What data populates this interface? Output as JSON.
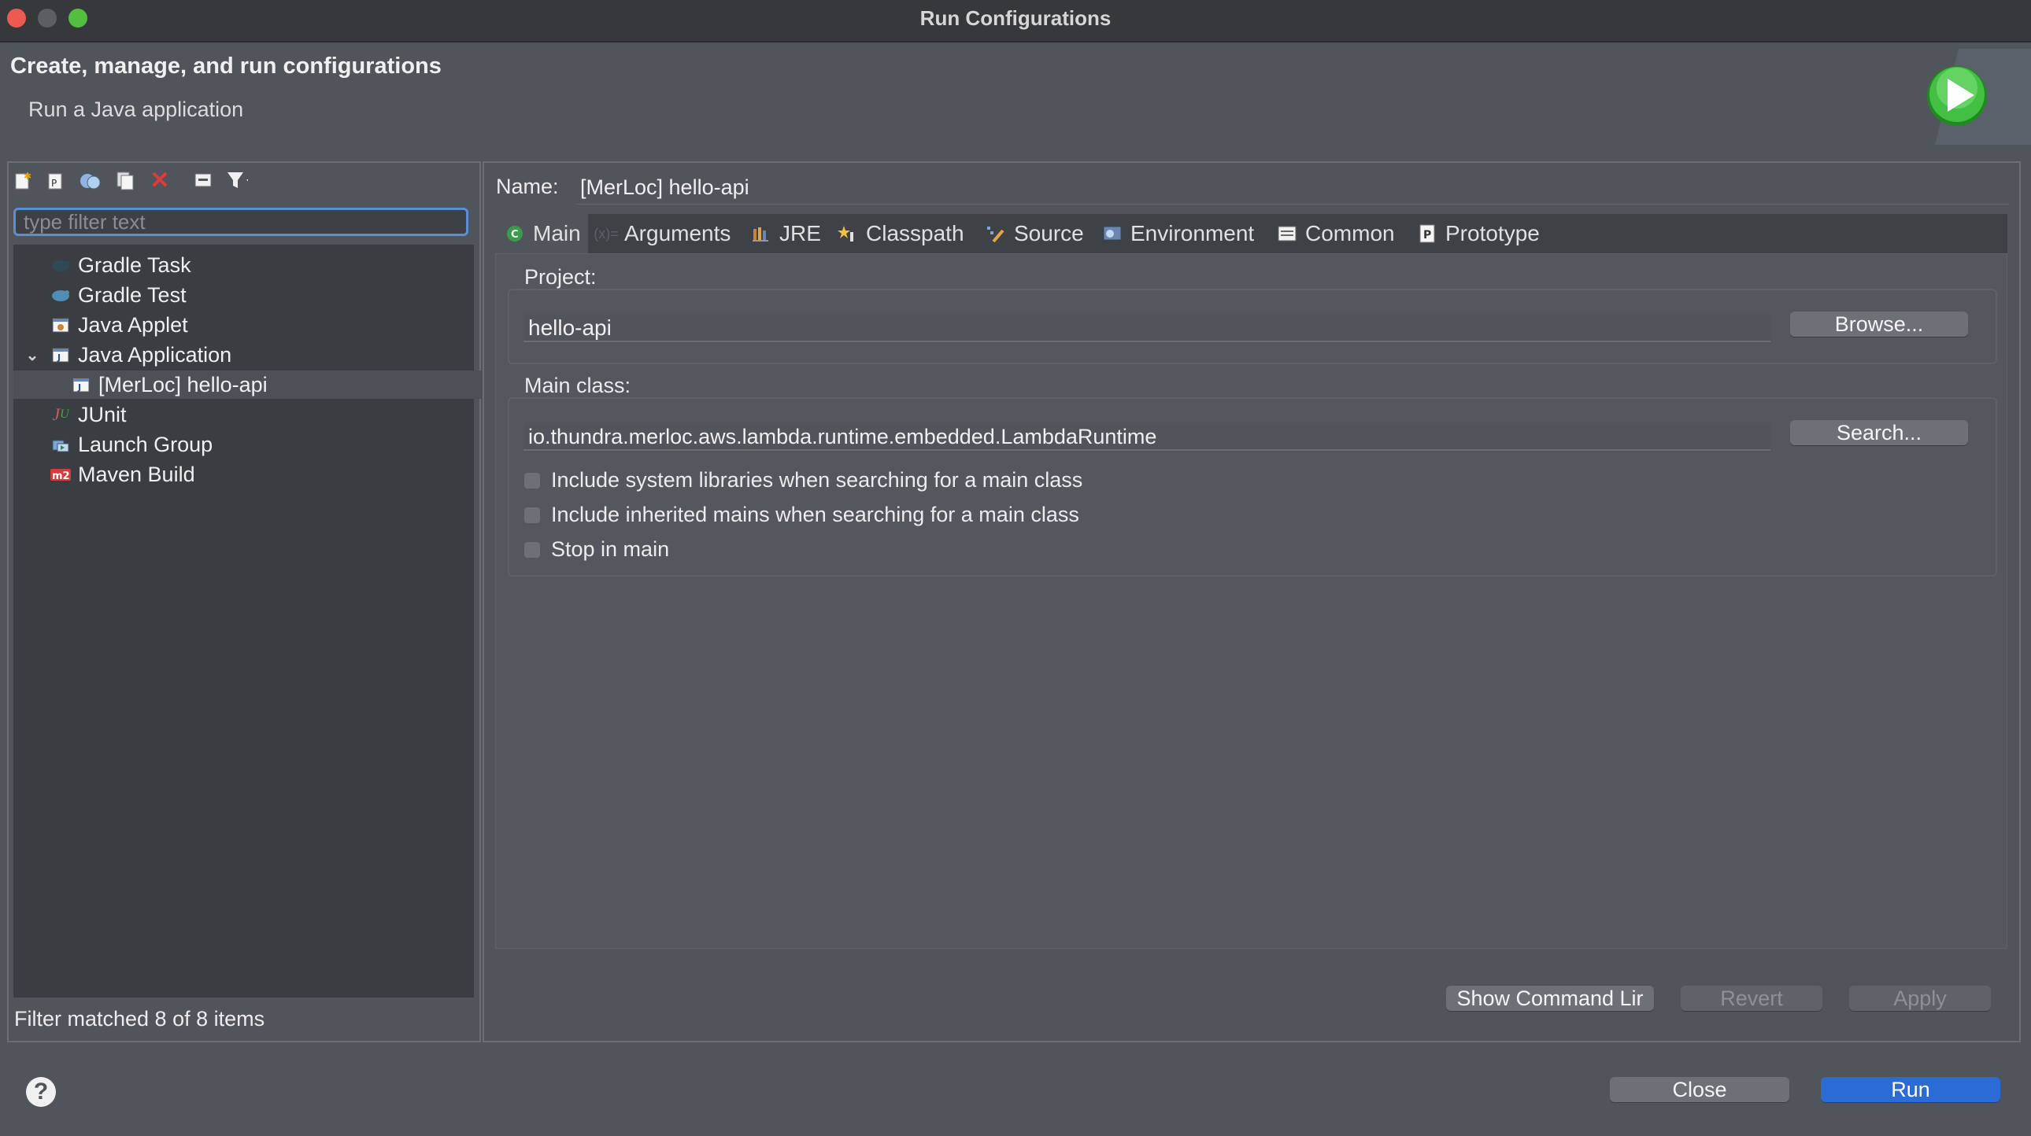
{
  "window": {
    "title": "Run Configurations"
  },
  "header": {
    "title": "Create, manage, and run configurations",
    "subtitle": "Run a Java application",
    "run_icon": "run-icon"
  },
  "left": {
    "toolbar_icons": [
      "new-config-icon",
      "new-prototype-icon",
      "duplicate-icon",
      "export-icon",
      "delete-icon",
      "collapse-all-icon",
      "filter-icon"
    ],
    "filter_placeholder": "type filter text",
    "tree": [
      {
        "label": "Gradle Task",
        "icon": "gradle-icon"
      },
      {
        "label": "Gradle Test",
        "icon": "gradle-test-icon"
      },
      {
        "label": "Java Applet",
        "icon": "java-applet-icon"
      },
      {
        "label": "Java Application",
        "icon": "java-application-icon",
        "expanded": true
      },
      {
        "label": "[MerLoc] hello-api",
        "icon": "java-config-icon",
        "selected": true
      },
      {
        "label": "JUnit",
        "icon": "junit-icon"
      },
      {
        "label": "Launch Group",
        "icon": "launch-group-icon"
      },
      {
        "label": "Maven Build",
        "icon": "maven-icon"
      }
    ],
    "status": "Filter matched 8 of 8 items"
  },
  "right": {
    "name_label": "Name:",
    "name_value": "[MerLoc] hello-api",
    "tabs": [
      {
        "label": "Main",
        "icon": "main-class-icon",
        "active": true
      },
      {
        "label": "Arguments",
        "icon": "arguments-icon"
      },
      {
        "label": "JRE",
        "icon": "jre-icon"
      },
      {
        "label": "Classpath",
        "icon": "classpath-icon"
      },
      {
        "label": "Source",
        "icon": "source-icon"
      },
      {
        "label": "Environment",
        "icon": "environment-icon"
      },
      {
        "label": "Common",
        "icon": "common-icon"
      },
      {
        "label": "Prototype",
        "icon": "prototype-icon"
      }
    ],
    "project_label": "Project:",
    "project_value": "hello-api",
    "browse_label": "Browse...",
    "main_class_label": "Main class:",
    "main_class_value": "io.thundra.merloc.aws.lambda.runtime.embedded.LambdaRuntime",
    "search_label": "Search...",
    "checkboxes": [
      {
        "label": "Include system libraries when searching for a main class",
        "checked": false
      },
      {
        "label": "Include inherited mains when searching for a main class",
        "checked": false
      },
      {
        "label": "Stop in main",
        "checked": false
      }
    ],
    "show_command_label": "Show Command Lir",
    "revert_label": "Revert",
    "apply_label": "Apply"
  },
  "footer": {
    "help_icon": "help-icon",
    "close_label": "Close",
    "run_label": "Run"
  },
  "colors": {
    "background": "#50545b",
    "titlebar": "#36383c",
    "accent": "#2a6bd6",
    "focus_ring": "#5a8fd6"
  }
}
